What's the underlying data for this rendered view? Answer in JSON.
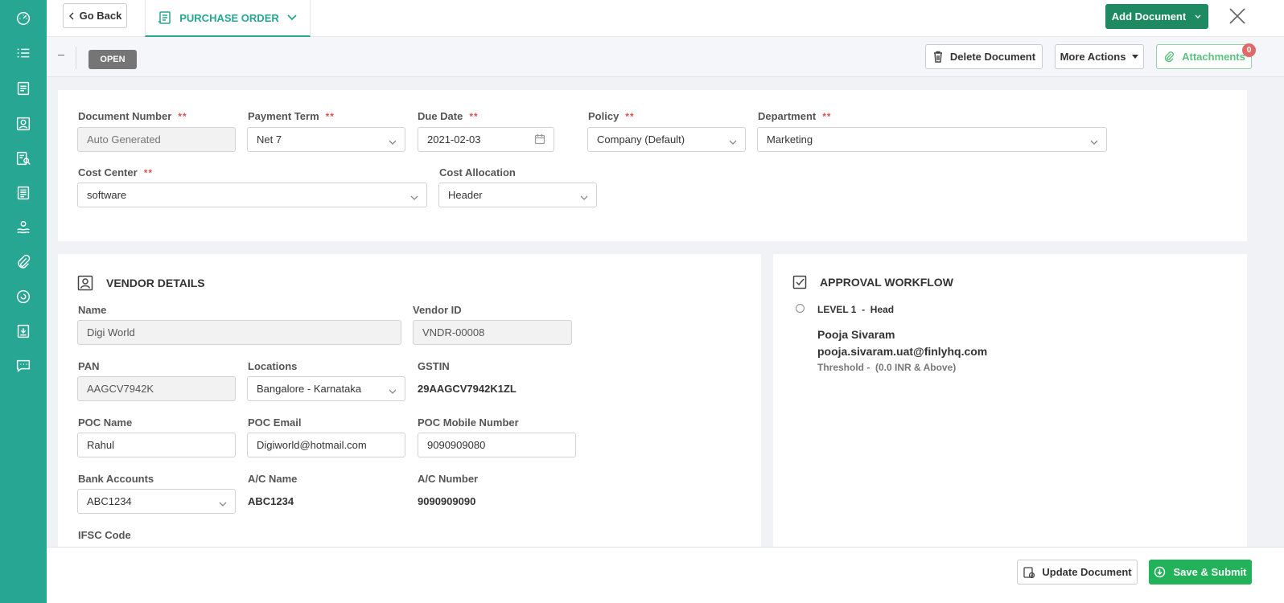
{
  "colors": {
    "sidebar": "#26a693",
    "accent": "#26a693",
    "primary_button": "#1e8a62",
    "submit_button": "#22b25a",
    "required": "#d9534f",
    "attachments": "#5cc07e",
    "badge": "#e06a6a"
  },
  "sidebar": {
    "items": [
      {
        "icon": "dashboard-icon"
      },
      {
        "icon": "list-icon"
      },
      {
        "icon": "document-icon"
      },
      {
        "icon": "contact-icon"
      },
      {
        "icon": "vendor-search-icon"
      },
      {
        "icon": "report-icon"
      },
      {
        "icon": "payment-icon"
      },
      {
        "icon": "attachment-icon"
      },
      {
        "icon": "sync-icon"
      },
      {
        "icon": "download-report-icon"
      },
      {
        "icon": "chat-icon"
      }
    ]
  },
  "header": {
    "go_back": "Go Back",
    "tab_label": "PURCHASE ORDER",
    "add_document": "Add Document"
  },
  "toolbar": {
    "status": "OPEN",
    "delete_document": "Delete Document",
    "more_actions": "More Actions",
    "attachments": "Attachments",
    "attachments_count": "0"
  },
  "document": {
    "document_number": {
      "label": "Document Number",
      "required": "**",
      "placeholder": "Auto Generated"
    },
    "payment_term": {
      "label": "Payment Term",
      "required": "**",
      "value": "Net 7"
    },
    "due_date": {
      "label": "Due Date",
      "required": "**",
      "value": "2021-02-03"
    },
    "policy": {
      "label": "Policy",
      "required": "**",
      "value": "Company (Default)"
    },
    "department": {
      "label": "Department",
      "required": "**",
      "value": "Marketing"
    },
    "cost_center": {
      "label": "Cost Center",
      "required": "**",
      "value": "software"
    },
    "cost_allocation": {
      "label": "Cost Allocation",
      "value": "Header"
    }
  },
  "vendor": {
    "title": "VENDOR DETAILS",
    "name": {
      "label": "Name",
      "value": "Digi World"
    },
    "vendor_id": {
      "label": "Vendor ID",
      "value": "VNDR-00008"
    },
    "pan": {
      "label": "PAN",
      "value": "AAGCV7942K"
    },
    "locations": {
      "label": "Locations",
      "value": "Bangalore - Karnataka"
    },
    "gstin": {
      "label": "GSTIN",
      "value": "29AAGCV7942K1ZL"
    },
    "poc_name": {
      "label": "POC Name",
      "value": "Rahul"
    },
    "poc_email": {
      "label": "POC Email",
      "value": "Digiworld@hotmail.com"
    },
    "poc_mobile": {
      "label": "POC Mobile Number",
      "value": "9090909080"
    },
    "bank_accounts": {
      "label": "Bank Accounts",
      "value": "ABC1234"
    },
    "ac_name": {
      "label": "A/C Name",
      "value": "ABC1234"
    },
    "ac_number": {
      "label": "A/C Number",
      "value": "9090909090"
    },
    "ifsc": {
      "label": "IFSC Code"
    }
  },
  "approval": {
    "title": "APPROVAL WORKFLOW",
    "level": "LEVEL 1  -  Head",
    "approver_name": "Pooja Sivaram",
    "approver_email": "pooja.sivaram.uat@finlyhq.com",
    "threshold": "Threshold -  (0.0 INR & Above)"
  },
  "footer": {
    "update_document": "Update Document",
    "save_submit": "Save & Submit"
  }
}
